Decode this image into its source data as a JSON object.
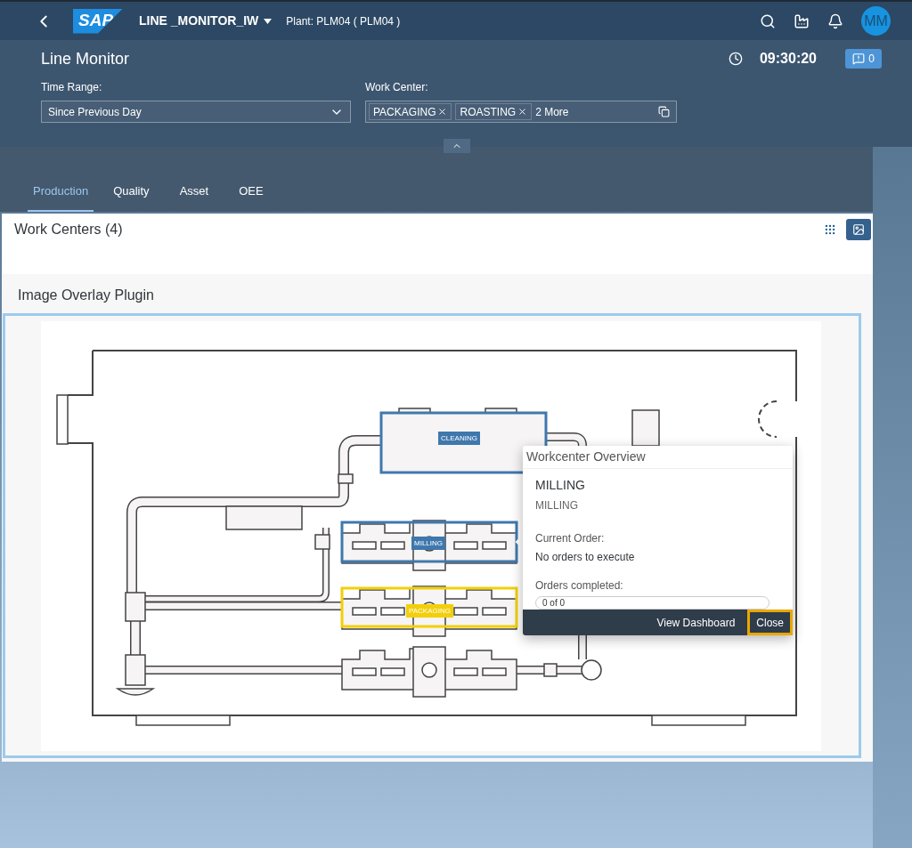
{
  "shell": {
    "logo": "SAP",
    "app_title": "LINE _MONITOR_IW",
    "plant": "Plant: PLM04 ( PLM04 )",
    "avatar": "MM"
  },
  "header": {
    "title": "Line Monitor",
    "time": "09:30:20",
    "alerts_count": "0"
  },
  "filters": {
    "time_range": {
      "label": "Time Range:",
      "value": "Since Previous Day"
    },
    "work_center": {
      "label": "Work Center:",
      "tokens": [
        "PACKAGING",
        "ROASTING"
      ],
      "more": "2 More"
    }
  },
  "tabs": [
    {
      "label": "Production",
      "selected": true
    },
    {
      "label": "Quality",
      "selected": false
    },
    {
      "label": "Asset",
      "selected": false
    },
    {
      "label": "OEE",
      "selected": false
    }
  ],
  "work_centers": {
    "title": "Work Centers (4)",
    "views": [
      {
        "kind": "grid",
        "selected": false
      },
      {
        "kind": "image",
        "selected": true
      }
    ]
  },
  "plugin": {
    "title": "Image Overlay Plugin",
    "markers": [
      {
        "label": "CLEANING",
        "color": "#3f78ad"
      },
      {
        "label": "MILLING",
        "color": "#3f78ad"
      },
      {
        "label": "PACKAGING",
        "color": "#f2cf0a"
      }
    ]
  },
  "popover": {
    "title": "Workcenter Overview",
    "name": "MILLING",
    "description": "MILLING",
    "order_label": "Current Order:",
    "order_value": "No orders to execute",
    "completed_label": "Orders completed:",
    "progress_text": "0 of 0",
    "level": 0,
    "buttons": [
      {
        "label": "View Dashboard",
        "focused": false
      },
      {
        "label": "Close",
        "focused": true
      }
    ]
  }
}
